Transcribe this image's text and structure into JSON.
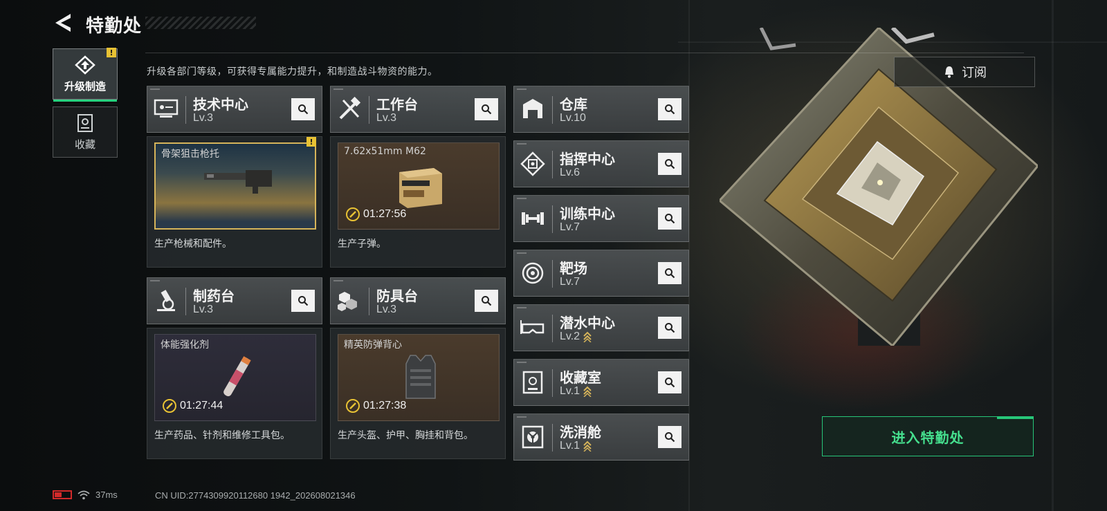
{
  "header": {
    "title": "特勤处"
  },
  "sidebar": {
    "tabs": [
      {
        "label": "升级制造",
        "icon": "upgrade-build-icon",
        "active": true,
        "badge": "!"
      },
      {
        "label": "收藏",
        "icon": "collection-icon",
        "active": false
      }
    ]
  },
  "description": "升级各部门等级，可获得专属能力提升，和制造战斗物资的能力。",
  "subscribe": {
    "label": "订阅",
    "icon": "bell-icon"
  },
  "production_departments": [
    {
      "name": "技术中心",
      "level": "Lv.3",
      "icon": "monitor-icon",
      "item": "骨架狙击枪托",
      "timer": "",
      "desc": "生产枪械和配件。",
      "badge": "!"
    },
    {
      "name": "工作台",
      "level": "Lv.3",
      "icon": "tools-icon",
      "item": "7.62x51mm M62",
      "timer": "01:27:56",
      "desc": "生产子弹。"
    },
    {
      "name": "制药台",
      "level": "Lv.3",
      "icon": "microscope-icon",
      "item": "体能强化剂",
      "timer": "01:27:44",
      "desc": "生产药品、针剂和维修工具包。"
    },
    {
      "name": "防具台",
      "level": "Lv.3",
      "icon": "armor-blocks-icon",
      "item": "精英防弹背心",
      "timer": "01:27:38",
      "desc": "生产头盔、护甲、胸挂和背包。"
    }
  ],
  "facilities": [
    {
      "name": "仓库",
      "level": "Lv.10",
      "icon": "warehouse-icon",
      "upgradable": false
    },
    {
      "name": "指挥中心",
      "level": "Lv.6",
      "icon": "chip-icon",
      "upgradable": false
    },
    {
      "name": "训练中心",
      "level": "Lv.7",
      "icon": "dumbbell-icon",
      "upgradable": false
    },
    {
      "name": "靶场",
      "level": "Lv.7",
      "icon": "target-icon",
      "upgradable": false
    },
    {
      "name": "潜水中心",
      "level": "Lv.2",
      "icon": "diving-mask-icon",
      "upgradable": true
    },
    {
      "name": "收藏室",
      "level": "Lv.1",
      "icon": "trophy-case-icon",
      "upgradable": true
    },
    {
      "name": "洗消舱",
      "level": "Lv.1",
      "icon": "radiation-icon",
      "upgradable": true
    }
  ],
  "enter_button": {
    "label": "进入特勤处"
  },
  "status": {
    "ping": "37ms",
    "uid": "CN UID:2774309920112680 1942_202608021346"
  },
  "colors": {
    "accent_green": "#27c679",
    "warning_yellow": "#e8c234",
    "battery_red": "#d22a2a",
    "gold_frame": "#d6b45a"
  }
}
